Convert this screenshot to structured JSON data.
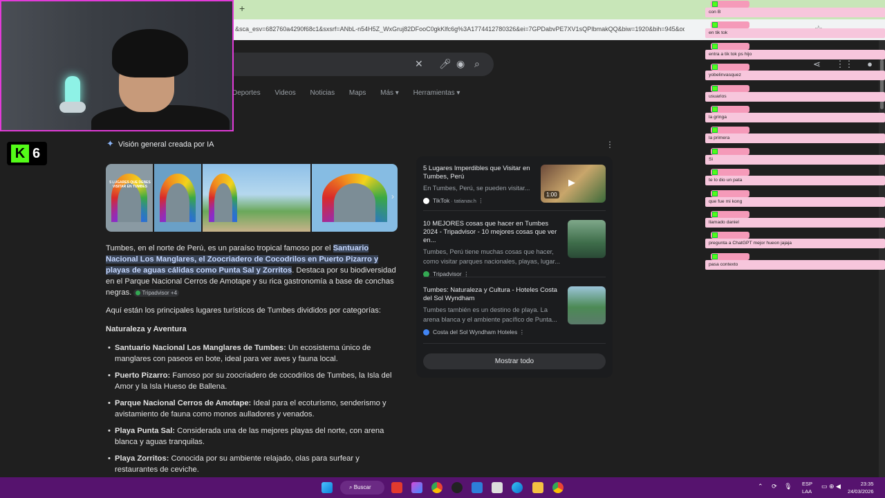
{
  "browser": {
    "new_tab": "+",
    "url": "&sca_esv=682760a4290f68c1&sxsrf=ANbL-n54H5Z_WxGruj82DFooC0gkKlfc6g%3A1774412780326&ei=7GPDabvPE7XV1sQPIbmakQQ&biw=1920&bih=945&oq=tur..."
  },
  "search": {
    "tabs": [
      "Deportes",
      "Videos",
      "Noticias",
      "Maps",
      "Más ▾",
      "Herramientas ▾"
    ]
  },
  "ai_overview": {
    "header": "Visión general creada por IA",
    "lead_1": "Tumbes, en el norte de Perú, es un paraíso tropical famoso por el ",
    "lead_hl": "Santuario Nacional Los Manglares, el Zoocriadero de Cocodrilos en Puerto Pizarro y playas de aguas cálidas como Punta Sal y Zorritos",
    "lead_2": ". Destaca por su biodiversidad en el Parque Nacional Cerros de Amotape y su rica gastronomía a base de conchas negras.",
    "lead_chip": "Tripadvisor +4",
    "intro": "Aquí están los principales lugares turísticos de Tumbes divididos por categorías:",
    "section": "Naturaleza y Aventura",
    "thumb_caption": "5 LUGARES QUE DEBES VISITAR EN TUMBES",
    "items": [
      {
        "title": "Santuario Nacional Los Manglares de Tumbes:",
        "text": " Un ecosistema único de manglares con paseos en bote, ideal para ver aves y fauna local."
      },
      {
        "title": "Puerto Pizarro:",
        "text": " Famoso por su zoocriadero de cocodrilos de Tumbes, la Isla del Amor y la Isla Hueso de Ballena."
      },
      {
        "title": "Parque Nacional Cerros de Amotape:",
        "text": " Ideal para el ecoturismo, senderismo y avistamiento de fauna como monos aulladores y venados."
      },
      {
        "title": "Playa Punta Sal:",
        "text": " Considerada una de las mejores playas del norte, con arena blanca y aguas tranquilas."
      },
      {
        "title": "Playa Zorritos:",
        "text": " Conocida por su ambiente relajado, olas para surfear y restaurantes de ceviche."
      }
    ]
  },
  "sources": {
    "items": [
      {
        "title": "5 Lugares Imperdibles que Visitar en Tumbes, Perú",
        "desc": "En Tumbes, Perú, se pueden visitar...",
        "site": "TikTok",
        "site_sub": " · tatianav.h",
        "duration": "1:00",
        "color": "#ffffff"
      },
      {
        "title": "10 MEJORES cosas que hacer en Tumbes 2024 - Tripadvisor - 10 mejores cosas que ver en...",
        "desc": "Tumbes, Perú tiene muchas cosas que hacer, como visitar parques nacionales, playas, lugar...",
        "site": "Tripadvisor",
        "site_sub": "",
        "color": "#34a853"
      },
      {
        "title": "Tumbes: Naturaleza y Cultura - Hoteles Costa del Sol Wyndham",
        "desc": "Tumbes también es un destino de playa. La arena blanca y el ambiente pacífico de Punta...",
        "site": "Costa del Sol Wyndham Hoteles",
        "site_sub": "",
        "color": "#4285f4"
      }
    ],
    "show_all": "Mostrar todo"
  },
  "stream": {
    "kick_logo": "K",
    "viewers": "6",
    "chat": [
      "con B",
      "en tik tok",
      "entra a tik tok ps hijo",
      "yobelinvasquez",
      "usuarios",
      "la gringa",
      "la primera",
      "Si",
      "te lo dio un pata",
      "que fue mi kong",
      "llamado daniel",
      "pregunta a ChatGPT mejor hueon jajaja",
      "pasa contexto"
    ]
  },
  "taskbar": {
    "search": "Buscar",
    "lang_1": "ESP",
    "lang_2": "LAA",
    "time": "23:35",
    "date": "24/03/2026"
  }
}
